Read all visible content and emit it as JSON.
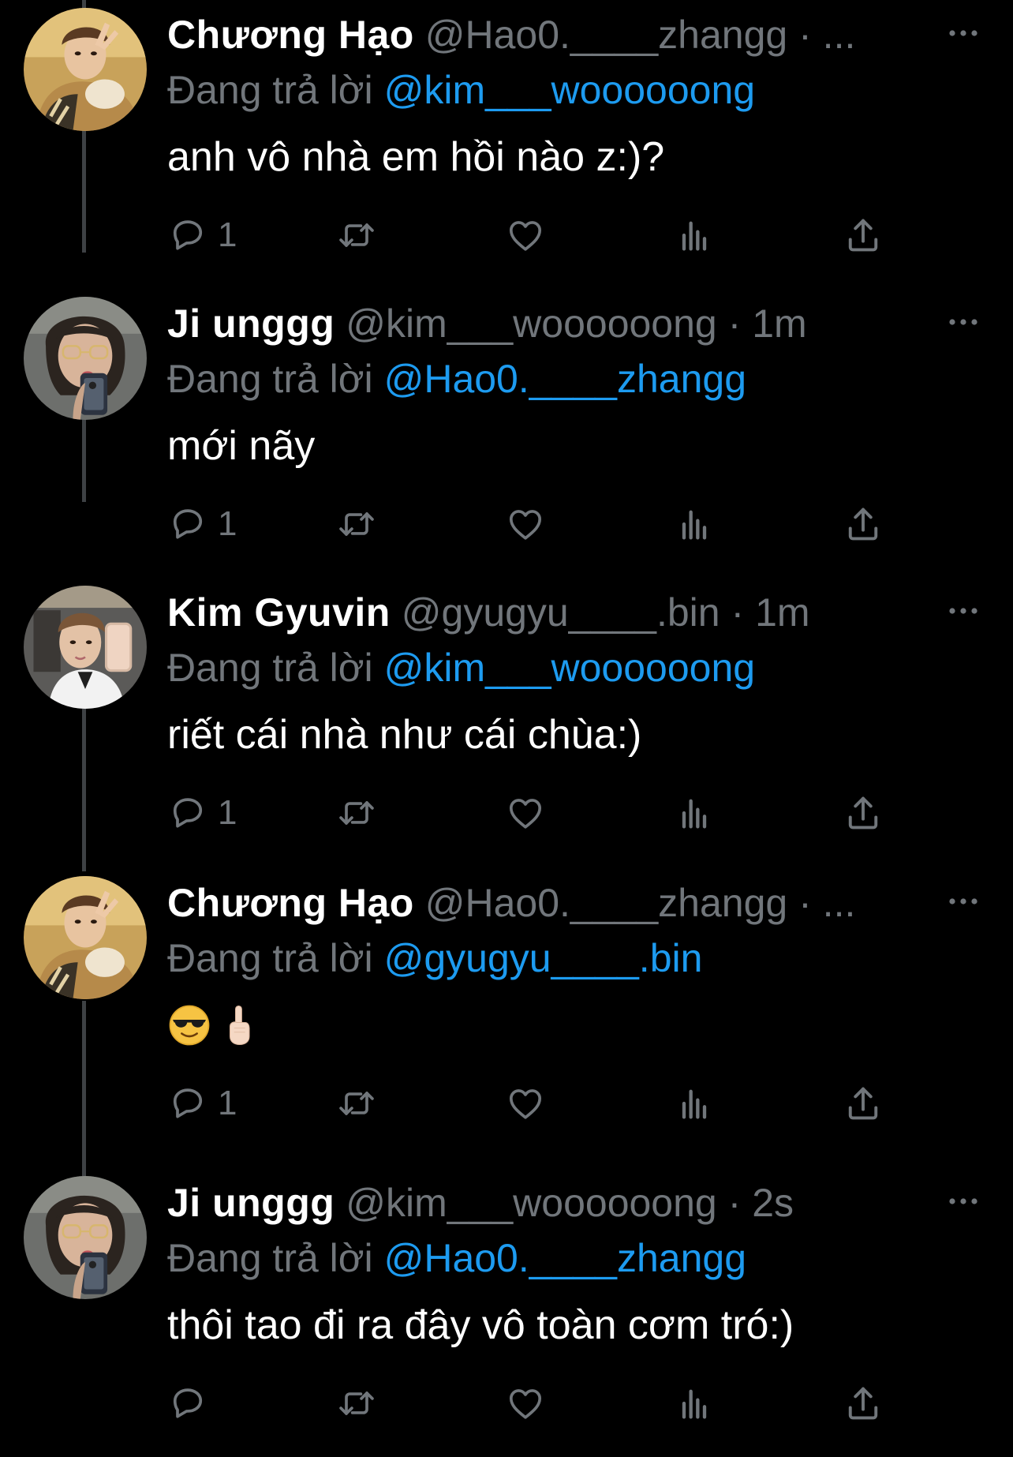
{
  "reply_prefix": "Đang trả lời",
  "colors": {
    "background": "#000000",
    "name": "#ffffff",
    "secondary": "#71767b",
    "mention": "#1d9bf0",
    "thread_line": "#3e4144"
  },
  "tweets": [
    {
      "author": "Chương Hạo",
      "handle": "@Hao0.____zhangg",
      "separator": "·",
      "time": "...",
      "replying_to": "@kim___woooooong",
      "text": "anh vô nhà em hồi nào z:)?",
      "reply_count": "1"
    },
    {
      "author": "Ji unggg",
      "handle": "@kim___woooooong",
      "separator": "·",
      "time": "1m",
      "replying_to": "@Hao0.____zhangg",
      "text": "mới nãy",
      "reply_count": "1"
    },
    {
      "author": "Kim Gyuvin",
      "handle": "@gyugyu____.bin",
      "separator": "·",
      "time": "1m",
      "replying_to": "@kim___woooooong",
      "text": "riết cái nhà như cái chùa:)",
      "reply_count": "1"
    },
    {
      "author": "Chương Hạo",
      "handle": "@Hao0.____zhangg",
      "separator": "·",
      "time": "...",
      "replying_to": "@gyugyu____.bin",
      "emojis": [
        "smiling-face-with-sunglasses",
        "index-pointing-up"
      ],
      "reply_count": "1"
    },
    {
      "author": "Ji unggg",
      "handle": "@kim___woooooong",
      "separator": "·",
      "time": "2s",
      "replying_to": "@Hao0.____zhangg",
      "text": "thôi tao đi ra đây vô toàn cơm tró:)",
      "reply_count": ""
    }
  ],
  "action_icons": [
    "reply-icon",
    "retweet-icon",
    "like-icon",
    "views-icon",
    "share-icon"
  ]
}
